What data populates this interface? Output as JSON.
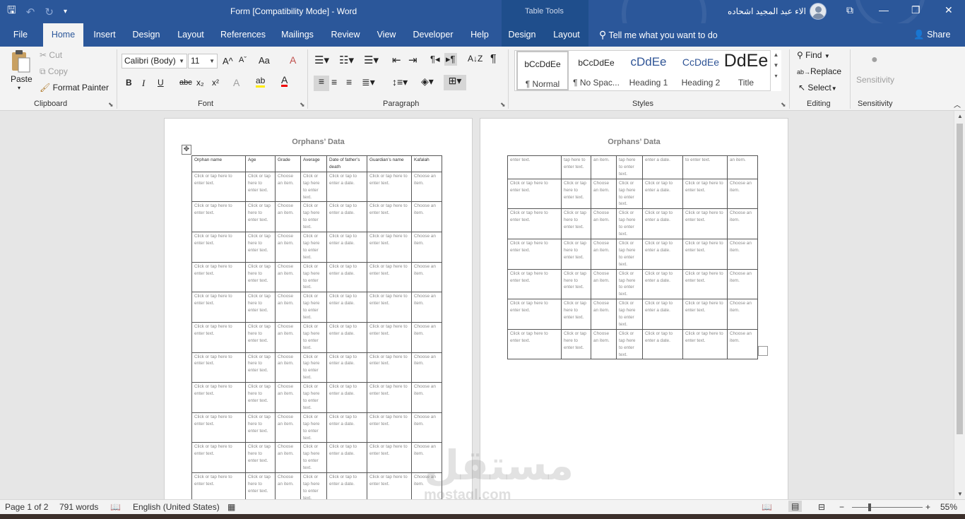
{
  "titlebar": {
    "doc_title": "Form [Compatibility Mode]  -  Word",
    "context_label": "Table Tools",
    "user_name": "الاء عبد المجيد اشحاده",
    "qat_save": "🖫",
    "qat_undo": "↶",
    "qat_redo": "↻",
    "qat_more": "▾",
    "btn_ribbon_display": "⧉",
    "btn_minimize": "—",
    "btn_restore": "❐",
    "btn_close": "✕"
  },
  "tabs": {
    "file": "File",
    "home": "Home",
    "insert": "Insert",
    "design": "Design",
    "layout": "Layout",
    "references": "References",
    "mailings": "Mailings",
    "review": "Review",
    "view": "View",
    "developer": "Developer",
    "help": "Help",
    "table_design": "Design",
    "table_layout": "Layout",
    "tell_me": "Tell me what you want to do",
    "share": "Share"
  },
  "clipboard": {
    "paste": "Paste",
    "cut": "Cut",
    "copy": "Copy",
    "format_painter": "Format Painter",
    "group": "Clipboard"
  },
  "font": {
    "font_name": "Calibri (Body)",
    "font_size": "11",
    "group": "Font",
    "bold": "B",
    "italic": "I",
    "underline": "U",
    "strike": "abc",
    "subscript": "x₂",
    "superscript": "x²",
    "grow": "A^",
    "shrink": "Aˇ",
    "case": "Aa",
    "clear": "A",
    "color": "A",
    "highlight": "ab",
    "effects": "A"
  },
  "paragraph": {
    "group": "Paragraph",
    "pilcrow": "¶",
    "sort": "A↓Z"
  },
  "styles": {
    "group": "Styles",
    "items": [
      {
        "preview": "bCcDdEe",
        "name": "¶ Normal"
      },
      {
        "preview": "bCcDdEe",
        "name": "¶ No Spac..."
      },
      {
        "preview": "cDdEe",
        "name": "Heading 1"
      },
      {
        "preview": "CcDdEe",
        "name": "Heading 2"
      },
      {
        "preview": "DdEe",
        "name": "Title"
      }
    ]
  },
  "editing": {
    "find": "Find",
    "replace": "Replace",
    "select": "Select",
    "group": "Editing"
  },
  "sensitivity": {
    "label": "Sensitivity",
    "group": "Sensitivity"
  },
  "document": {
    "page1_title": "Orphans’ Data",
    "page2_title": "Orphans’ Data",
    "headers": [
      "Orphan name",
      "Age",
      "Grade",
      "Average",
      "Date of father’s death",
      "Guardian’s name",
      "Kafalah"
    ],
    "cells": [
      "Click or tap here to enter text.",
      "Click or tap here to enter text.",
      "Choose an item.",
      "Click or tap here to enter text.",
      "Click or tap to enter a date.",
      "Click or tap here to enter text.",
      "Choose an item."
    ],
    "page2_first_row": [
      "enter text.",
      "tap here to enter text.",
      "an item.",
      "tap here to enter text.",
      "enter a date.",
      "to enter text.",
      "an item."
    ]
  },
  "status": {
    "page": "Page 1 of 2",
    "words": "791 words",
    "language": "English (United States)",
    "zoom": "55%",
    "zoom_minus": "−",
    "zoom_plus": "+"
  },
  "watermark": {
    "brand": "مستقل",
    "url": "mostaql.com"
  }
}
